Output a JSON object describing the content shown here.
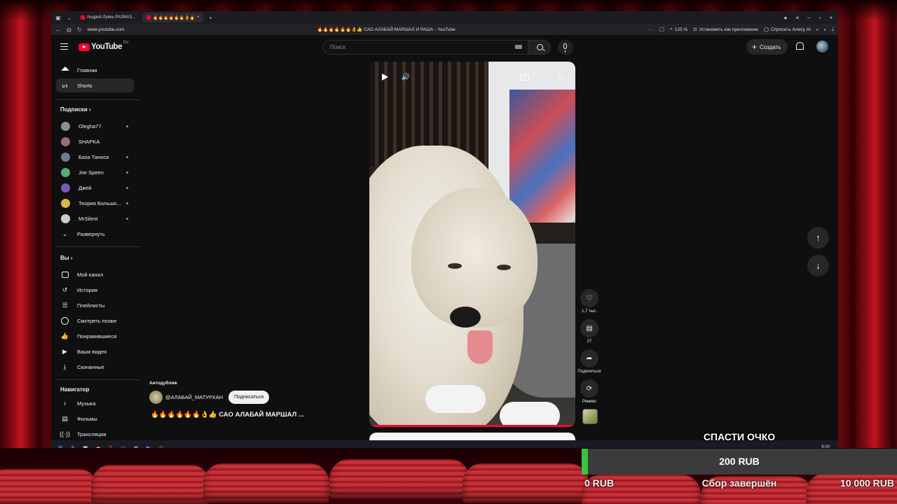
{
  "browser": {
    "tabs": [
      {
        "label": "Андрей Лукин РАЗМАЗ..."
      },
      {
        "label": "🔥🔥🔥🔥🔥🔥👌🔥"
      }
    ],
    "url": "www.youtube.com",
    "page_title": "🔥🔥🔥🔥🔥🔥👌👍 САО АЛАБАЙ МАРШАЛ И РАША - YouTube",
    "zoom": "125 %",
    "install_app": "Установить как приложение",
    "ask_alice": "Спросить Алису AI"
  },
  "header": {
    "logo_text": "YouTube",
    "logo_region": "RU",
    "search_placeholder": "Поиск",
    "create_label": "Создать"
  },
  "sidebar": {
    "main": [
      {
        "label": "Главная",
        "icon": "home-icon"
      },
      {
        "label": "Shorts",
        "icon": "shorts-icon"
      }
    ],
    "subscriptions_title": "Подписки",
    "subscriptions": [
      {
        "label": "Olegha77",
        "color": "#8a8f95",
        "new": true
      },
      {
        "label": "SHAPKA",
        "color": "#9b6b7a",
        "new": false
      },
      {
        "label": "База Таноса",
        "color": "#6a7e8e",
        "new": true
      },
      {
        "label": "Joe Speen",
        "color": "#5aa87a",
        "new": true
      },
      {
        "label": "Джей",
        "color": "#7a5ab8",
        "new": true
      },
      {
        "label": "Теория Большо...",
        "color": "#d6b84a",
        "new": true
      },
      {
        "label": "MrSilent",
        "color": "#cccccc",
        "new": true
      }
    ],
    "expand_label": "Развернуть",
    "you_title": "Вы",
    "you": [
      {
        "label": "Мой канал"
      },
      {
        "label": "История"
      },
      {
        "label": "Плейлисты"
      },
      {
        "label": "Смотреть позже"
      },
      {
        "label": "Понравившиеся"
      },
      {
        "label": "Ваши видео"
      },
      {
        "label": "Скачанные"
      }
    ],
    "nav_title": "Навигатор",
    "nav": [
      {
        "label": "Музыка"
      },
      {
        "label": "Фильмы"
      },
      {
        "label": "Трансляции"
      }
    ]
  },
  "short": {
    "autodub": "Автодубляж",
    "channel": "@АЛАБАЙ_МАТУРХАН",
    "subscribe": "Подписаться",
    "title": "🔥🔥🔥🔥🔥🔥👌👍 САО АЛАБАЙ МАРШАЛ ...",
    "likes": "1,7 тыс.",
    "comments": "27",
    "share": "Поделиться",
    "remix": "Ремикс"
  },
  "taskbar": {
    "time": "9:00"
  },
  "donation": {
    "title": "СПАСТИ ОЧКО",
    "current": "200 RUB",
    "min": "0 RUB",
    "max": "10 000 RUB",
    "status": "Сбор завершён",
    "progress_fraction": 0.02,
    "fill_color": "#39c43f"
  }
}
